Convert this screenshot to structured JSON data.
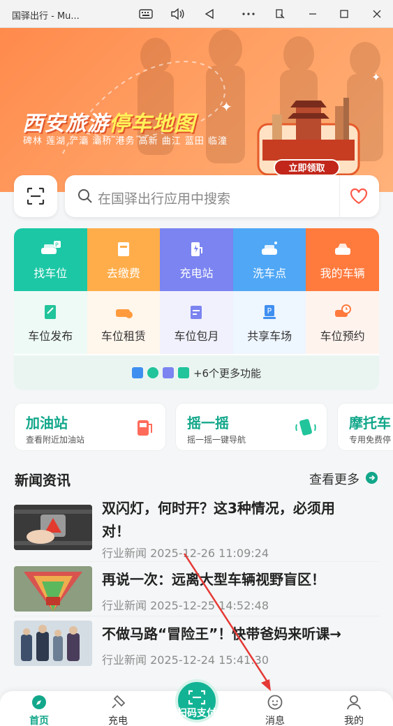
{
  "window": {
    "title": "国驿出行 - Mu...",
    "controls": [
      "keyboard-icon",
      "volume-icon",
      "back-icon",
      "more-icon",
      "rotate-icon",
      "minimize-icon",
      "maximize-icon",
      "close-icon"
    ]
  },
  "banner": {
    "headline_a": "西安旅游",
    "headline_b": "停车地图",
    "places": "碑林 莲湖 浐灞 灞桥 港务 高新 曲江 蓝田 临潼",
    "cta": "立即领取"
  },
  "search": {
    "placeholder": "在国驿出行应用中搜索"
  },
  "grid": {
    "row1": [
      {
        "label": "找车位",
        "color": "#1cc7a6"
      },
      {
        "label": "去缴费",
        "color": "#ffad4a"
      },
      {
        "label": "充电站",
        "color": "#7b84f0"
      },
      {
        "label": "洗车点",
        "color": "#4fa7f5"
      },
      {
        "label": "我的车辆",
        "color": "#ff7a3d"
      }
    ],
    "row2": [
      {
        "label": "车位发布",
        "bg": "#eefaf6",
        "icolor": "#21c49b"
      },
      {
        "label": "车位租赁",
        "bg": "#fff6ec",
        "icolor": "#ff9b3d"
      },
      {
        "label": "车位包月",
        "bg": "#f1f1fd",
        "icolor": "#7b84f0"
      },
      {
        "label": "共享车场",
        "bg": "#eef6ff",
        "icolor": "#3f8ff0"
      },
      {
        "label": "车位预约",
        "bg": "#fff3ee",
        "icolor": "#ff7a3d"
      }
    ],
    "more": "+6个更多功能"
  },
  "quick": [
    {
      "title": "加油站",
      "sub": "查看附近加油站"
    },
    {
      "title": "摇一摇",
      "sub": "摇一摇一键导航"
    },
    {
      "title": "摩托车",
      "sub": "专用免费停"
    }
  ],
  "news": {
    "heading": "新闻资讯",
    "more": "查看更多",
    "items": [
      {
        "title": "双闪灯，何时开？这3种情况，必须用对！",
        "category": "行业新闻",
        "time": "2025-12-26 11:09:24"
      },
      {
        "title": "再说一次：远离大型车辆视野盲区！",
        "category": "行业新闻",
        "time": "2025-12-25 14:52:48"
      },
      {
        "title": "不做马路“冒险王”！快带爸妈来听课→",
        "category": "行业新闻",
        "time": "2025-12-24 15:41:30"
      }
    ]
  },
  "nav": {
    "home": "首页",
    "charge": "充电",
    "scan": "扫码支付",
    "messages": "消息",
    "mine": "我的"
  },
  "colors": {
    "accent": "#12a78a",
    "banner": "#ff8a4c",
    "annotation": "#e53935"
  }
}
